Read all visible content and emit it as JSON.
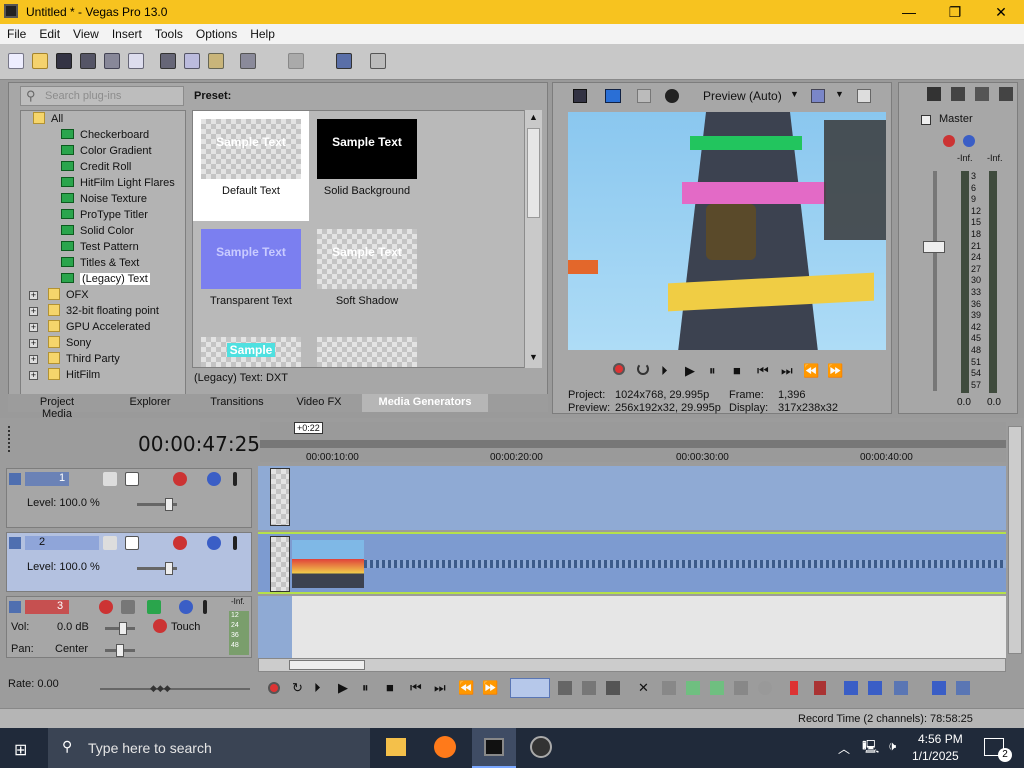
{
  "window": {
    "title": "Untitled * - Vegas Pro 13.0",
    "minimize": "—",
    "maximize": "❐",
    "close": "✕"
  },
  "menu": [
    "File",
    "Edit",
    "View",
    "Insert",
    "Tools",
    "Options",
    "Help"
  ],
  "plugins": {
    "search_placeholder": "Search plug-ins",
    "preset_label": "Preset:",
    "selected_plugin": "(Legacy) Text: DXT",
    "tree": [
      {
        "label": "All",
        "type": "folder"
      },
      {
        "label": "Checkerboard",
        "type": "gen"
      },
      {
        "label": "Color Gradient",
        "type": "gen"
      },
      {
        "label": "Credit Roll",
        "type": "gen"
      },
      {
        "label": "HitFilm Light Flares",
        "type": "gen"
      },
      {
        "label": "Noise Texture",
        "type": "gen"
      },
      {
        "label": "ProType Titler",
        "type": "gen"
      },
      {
        "label": "Solid Color",
        "type": "gen"
      },
      {
        "label": "Test Pattern",
        "type": "gen"
      },
      {
        "label": "Titles & Text",
        "type": "gen"
      },
      {
        "label": "(Legacy) Text",
        "type": "gen"
      },
      {
        "label": "OFX",
        "type": "folder"
      },
      {
        "label": "32-bit floating point",
        "type": "folder"
      },
      {
        "label": "GPU Accelerated",
        "type": "folder"
      },
      {
        "label": "Sony",
        "type": "folder"
      },
      {
        "label": "Third Party",
        "type": "folder"
      },
      {
        "label": "HitFilm",
        "type": "folder"
      }
    ],
    "presets": [
      {
        "label": "Default Text",
        "thumb": "Sample Text"
      },
      {
        "label": "Solid Background",
        "thumb": "Sample Text"
      },
      {
        "label": "Transparent Text",
        "thumb": "Sample Text"
      },
      {
        "label": "Soft Shadow",
        "thumb": "Sample Text"
      },
      {
        "label": "",
        "thumb": "Sample"
      },
      {
        "label": "",
        "thumb": ""
      }
    ]
  },
  "window_tabs": [
    "Project Media",
    "Explorer",
    "Transitions",
    "Video FX",
    "Media Generators"
  ],
  "preview": {
    "mode": "Preview (Auto)",
    "project_label": "Project:",
    "project_value": "1024x768, 29.995p",
    "preview_label": "Preview:",
    "preview_value": "256x192x32, 29.995p",
    "frame_label": "Frame:",
    "frame_value": "1,396",
    "display_label": "Display:",
    "display_value": "317x238x32"
  },
  "mixer": {
    "title": "Master",
    "inf_left": "-Inf.",
    "inf_right": "-Inf.",
    "scale": [
      "3",
      "6",
      "9",
      "12",
      "15",
      "18",
      "21",
      "24",
      "27",
      "30",
      "33",
      "36",
      "39",
      "42",
      "45",
      "48",
      "51",
      "54",
      "57"
    ],
    "bottom_left": "0.0",
    "bottom_right": "0.0"
  },
  "timeline": {
    "timecode": "00:00:47:25",
    "marker": "+0:22",
    "ruler": [
      "00:00:10:00",
      "00:00:20:00",
      "00:00:30:00",
      "00:00:40:00"
    ],
    "tracks": [
      {
        "num": "1",
        "level": "Level: 100.0 %"
      },
      {
        "num": "2",
        "level": "Level: 100.0 %"
      }
    ],
    "audio": {
      "num": "3",
      "vol_label": "Vol:",
      "vol_value": "0.0 dB",
      "pan_label": "Pan:",
      "pan_value": "Center",
      "automation": "Touch",
      "inf": "-Inf.",
      "meter": [
        "12",
        "24",
        "36",
        "48"
      ]
    },
    "rate": "Rate: 0.00"
  },
  "status": {
    "record_time": "Record Time (2 channels): 78:58:25"
  },
  "taskbar": {
    "search_placeholder": "Type here to search",
    "time": "4:56 PM",
    "date": "1/1/2025",
    "notifications": "2"
  },
  "colors": {
    "titlebar": "#f7c31f",
    "audio_track": "#c65050",
    "video_track": "#4f6fb0",
    "selection_green": "#2aa54c"
  }
}
